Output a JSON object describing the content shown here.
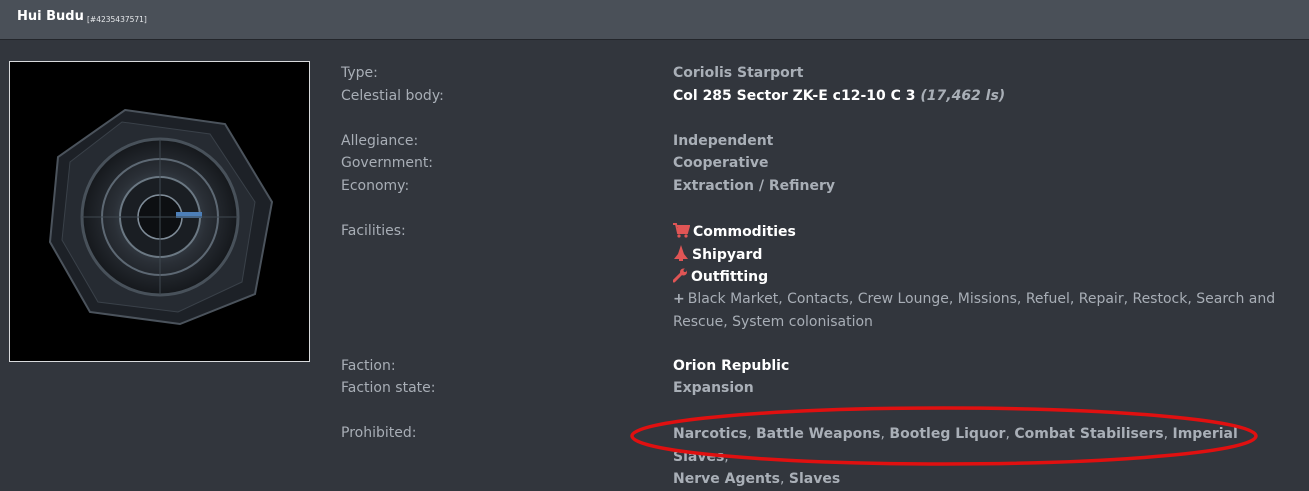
{
  "header": {
    "title": "Hui Budu",
    "station_id": "[#4235437571]"
  },
  "details": {
    "type_label": "Type:",
    "type_value": "Coriolis Starport",
    "body_label": "Celestial body:",
    "body_value": "Col 285 Sector ZK-E c12-10 C 3",
    "body_distance": "(17,462 ls)",
    "allegiance_label": "Allegiance:",
    "allegiance_value": "Independent",
    "government_label": "Government:",
    "government_value": "Cooperative",
    "economy_label": "Economy:",
    "economy_value": "Extraction / Refinery",
    "facilities_label": "Facilities:",
    "facilities": [
      {
        "icon": "shopping-cart-icon",
        "label": "Commodities"
      },
      {
        "icon": "ship-icon",
        "label": "Shipyard"
      },
      {
        "icon": "wrench-icon",
        "label": "Outfitting"
      }
    ],
    "other_services": "Black Market, Contacts, Crew Lounge, Missions, Refuel, Repair, Restock, Search and Rescue, System colonisation",
    "faction_label": "Faction:",
    "faction_value": "Orion Republic",
    "faction_state_label": "Faction state:",
    "faction_state_value": "Expansion",
    "prohibited_label": "Prohibited:",
    "prohibited": [
      "Narcotics",
      "Battle Weapons",
      "Bootleg Liquor",
      "Combat Stabilisers",
      "Imperial Slaves",
      "Nerve Agents",
      "Slaves"
    ]
  },
  "colors": {
    "facility_icon": "#e05555",
    "annotation_circle": "#e01010",
    "background": "#32363d",
    "header": "#4a5058"
  }
}
